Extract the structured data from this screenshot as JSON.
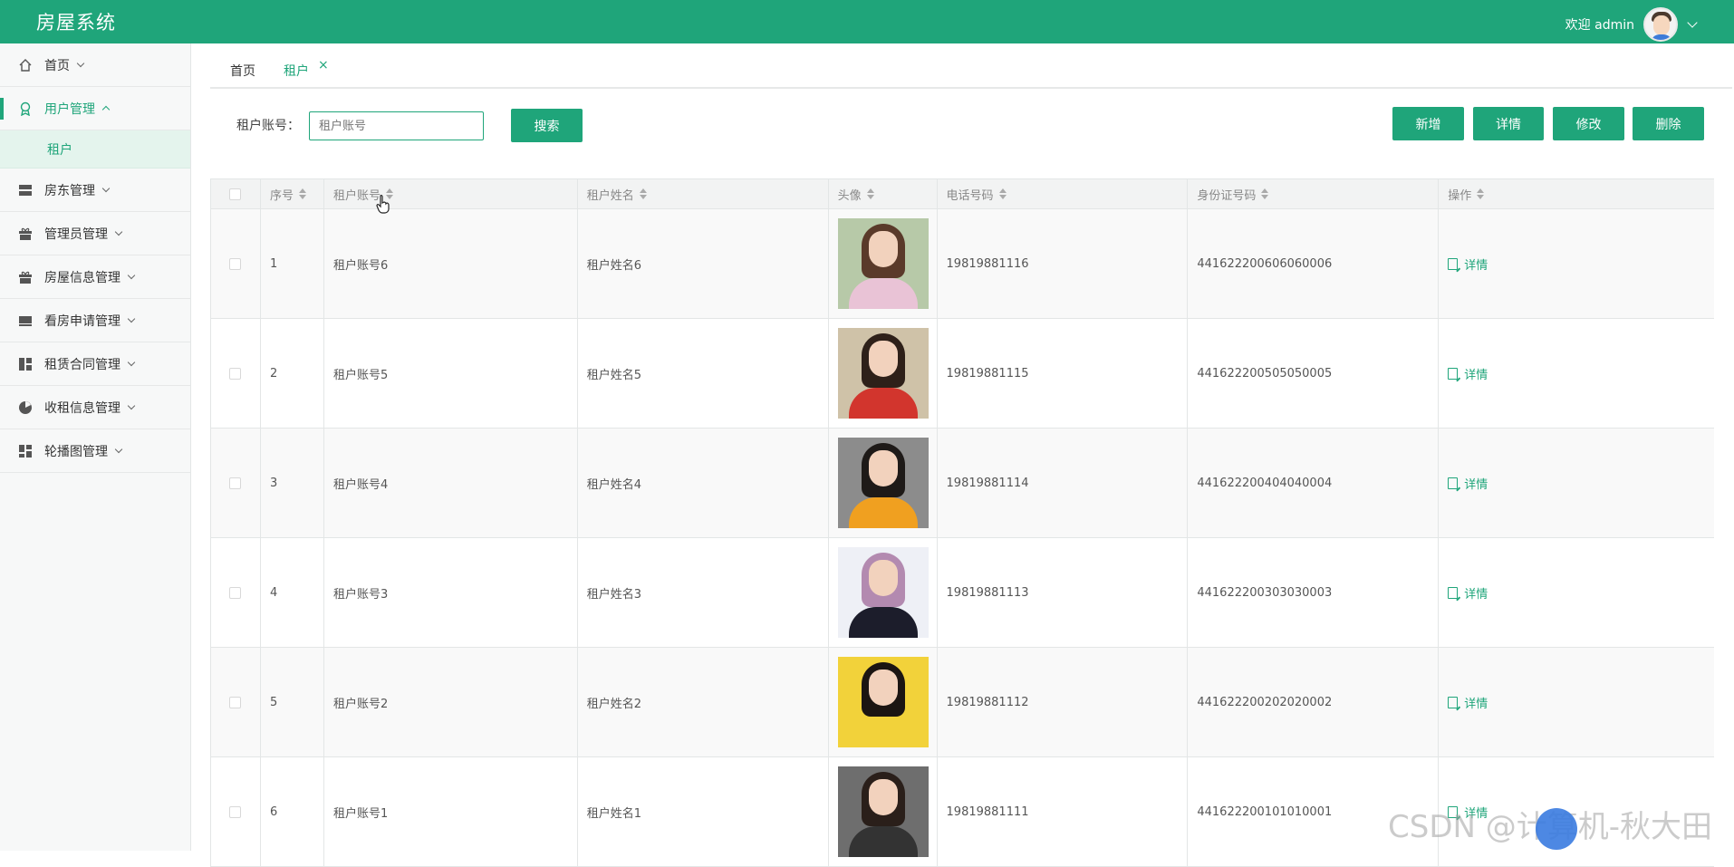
{
  "app": {
    "title": "房屋系统",
    "welcome": "欢迎 admin"
  },
  "sidebar": {
    "items": [
      {
        "label": "首页",
        "icon": "home-icon"
      },
      {
        "label": "用户管理",
        "icon": "badge-icon",
        "active": true,
        "children": [
          "租户"
        ]
      },
      {
        "label": "房东管理",
        "icon": "server-icon"
      },
      {
        "label": "管理员管理",
        "icon": "gift-icon"
      },
      {
        "label": "房屋信息管理",
        "icon": "gift-icon"
      },
      {
        "label": "看房申请管理",
        "icon": "monitor-icon"
      },
      {
        "label": "租赁合同管理",
        "icon": "grid-icon"
      },
      {
        "label": "收租信息管理",
        "icon": "pie-icon"
      },
      {
        "label": "轮播图管理",
        "icon": "grid-icon"
      }
    ]
  },
  "tabs": [
    {
      "label": "首页"
    },
    {
      "label": "租户",
      "closable": true,
      "close_glyph": "×"
    }
  ],
  "search": {
    "label": "租户账号：",
    "placeholder": "租户账号",
    "button": "搜索"
  },
  "actions": {
    "add": "新增",
    "detail": "详情",
    "edit": "修改",
    "delete": "删除"
  },
  "table": {
    "columns": [
      "序号",
      "租户账号",
      "租户姓名",
      "头像",
      "电话号码",
      "身份证号码",
      "操作"
    ],
    "rows": [
      {
        "no": "1",
        "account": "租户账号6",
        "name": "租户姓名6",
        "phone": "19819881116",
        "id_card": "441622200606060006",
        "op": "详情"
      },
      {
        "no": "2",
        "account": "租户账号5",
        "name": "租户姓名5",
        "phone": "19819881115",
        "id_card": "441622200505050005",
        "op": "详情"
      },
      {
        "no": "3",
        "account": "租户账号4",
        "name": "租户姓名4",
        "phone": "19819881114",
        "id_card": "441622200404040004",
        "op": "详情"
      },
      {
        "no": "4",
        "account": "租户账号3",
        "name": "租户姓名3",
        "phone": "19819881113",
        "id_card": "441622200303030003",
        "op": "详情"
      },
      {
        "no": "5",
        "account": "租户账号2",
        "name": "租户姓名2",
        "phone": "19819881112",
        "id_card": "441622200202020002",
        "op": "详情"
      },
      {
        "no": "6",
        "account": "租户账号1",
        "name": "租户姓名1",
        "phone": "19819881111",
        "id_card": "441622200101010001",
        "op": "详情"
      }
    ]
  },
  "watermark": "CSDN @计算机-秋大田",
  "colors": {
    "primary": "#1fa57a",
    "sidebar_bg": "#f7f8f8",
    "active_sub_bg": "#e4f4ed"
  }
}
